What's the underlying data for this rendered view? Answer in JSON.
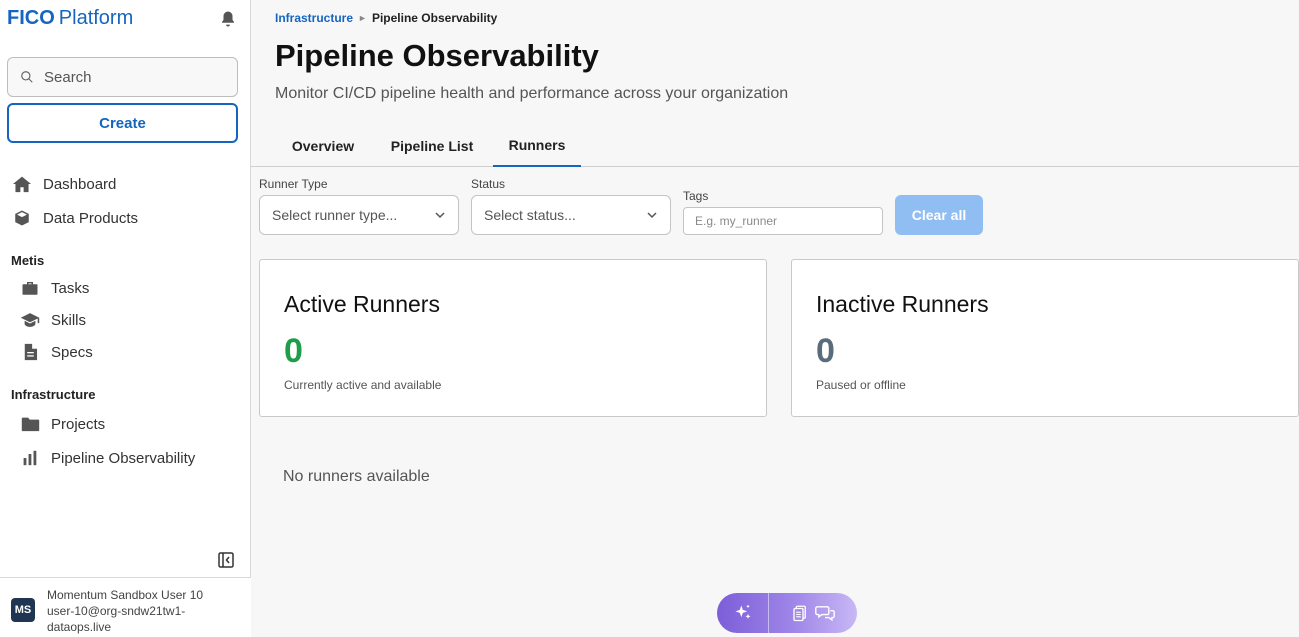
{
  "app": {
    "brand_bold": "FICO",
    "brand_light": "Platform",
    "accent": "#1565c0"
  },
  "sidebar": {
    "search_label": "Search",
    "create_label": "Create",
    "items": [
      {
        "label": "Dashboard",
        "icon": "home-icon"
      },
      {
        "label": "Data Products",
        "icon": "cube-icon"
      }
    ],
    "sections": [
      {
        "title": "Metis",
        "items": [
          {
            "label": "Tasks",
            "icon": "briefcase-icon"
          },
          {
            "label": "Skills",
            "icon": "graduation-cap-icon"
          },
          {
            "label": "Specs",
            "icon": "file-icon"
          }
        ]
      },
      {
        "title": "Infrastructure",
        "items": [
          {
            "label": "Projects",
            "icon": "folder-icon"
          },
          {
            "label": "Pipeline Observability",
            "icon": "bar-chart-icon"
          }
        ]
      }
    ],
    "user": {
      "initials": "MS",
      "name": "Momentum Sandbox User 10",
      "email": "user-10@org-sndw21tw1-dataops.live"
    }
  },
  "breadcrumb": {
    "parent": "Infrastructure",
    "current": "Pipeline Observability"
  },
  "page": {
    "title": "Pipeline Observability",
    "subtitle": "Monitor CI/CD pipeline health and performance across your organization"
  },
  "tabs": [
    {
      "label": "Overview",
      "active": false
    },
    {
      "label": "Pipeline List",
      "active": false
    },
    {
      "label": "Runners",
      "active": true
    }
  ],
  "filters": {
    "runner_type_label": "Runner Type",
    "runner_type_placeholder": "Select runner type...",
    "status_label": "Status",
    "status_placeholder": "Select status...",
    "tags_label": "Tags",
    "tags_placeholder": "E.g. my_runner",
    "clear_label": "Clear all"
  },
  "cards": {
    "active": {
      "title": "Active Runners",
      "count": "0",
      "desc": "Currently active and available",
      "color": "#1e9e4a"
    },
    "inactive": {
      "title": "Inactive Runners",
      "count": "0",
      "desc": "Paused or offline",
      "color": "#5a6b7b"
    }
  },
  "empty_message": "No runners available"
}
